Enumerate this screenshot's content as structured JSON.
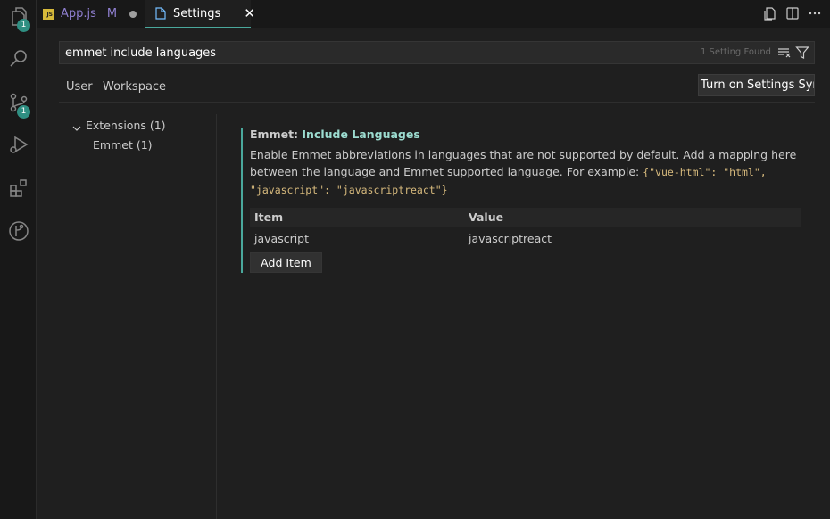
{
  "activity_bar": {
    "items": [
      {
        "icon": "files-icon",
        "badge": "1"
      },
      {
        "icon": "search-icon"
      },
      {
        "icon": "source-control-icon",
        "badge": "1"
      },
      {
        "icon": "run-debug-icon"
      },
      {
        "icon": "extensions-icon"
      },
      {
        "icon": "git-graph-icon"
      }
    ]
  },
  "tabs": {
    "appjs": {
      "icon_text": "JS",
      "label": "App.js",
      "status": "M"
    },
    "settings": {
      "label": "Settings",
      "close": "✕"
    }
  },
  "search": {
    "value": "emmet include languages",
    "count": "1 Setting Found"
  },
  "scopes": {
    "user": "User",
    "workspace": "Workspace"
  },
  "sync_button": "Turn on Settings Sync",
  "toc": {
    "extensions": "Extensions (1)",
    "emmet": "Emmet (1)"
  },
  "setting": {
    "category": "Emmet: ",
    "name": "Include Languages",
    "description": "Enable Emmet abbreviations in languages that are not supported by default. Add a mapping here between the language and Emmet supported language. For example: ",
    "example": "{\"vue-html\": \"html\", \"javascript\": \"javascriptreact\"}",
    "table": {
      "headers": {
        "item": "Item",
        "value": "Value"
      },
      "rows": [
        {
          "item": "javascript",
          "value": "javascriptreact"
        }
      ]
    },
    "add_item": "Add Item"
  },
  "colors": {
    "accent": "#4aa89c",
    "modified_tab": "#8f7fd0",
    "badge": "#2f8f82"
  }
}
